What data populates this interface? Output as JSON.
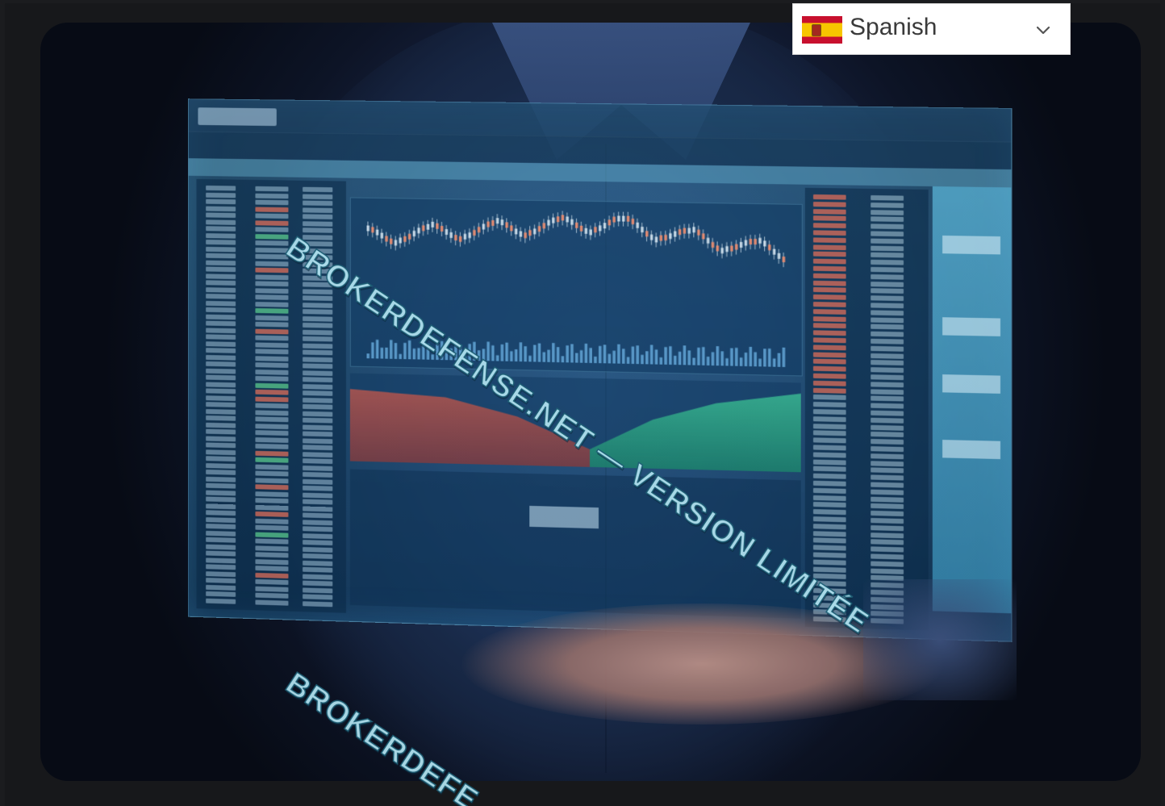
{
  "language_selector": {
    "selected": "Spanish",
    "flag_icon": "spain-flag-icon",
    "chevron_icon": "chevron-down-icon"
  },
  "watermark": {
    "line1": "BROKERDEFENSE.NET — VERSION LIMITÉE",
    "line2": "BROKERDEFE"
  },
  "colors": {
    "selector_bg": "#ffffff",
    "watermark_fill": "#aee0ee",
    "watermark_stroke": "#1d5e74"
  }
}
